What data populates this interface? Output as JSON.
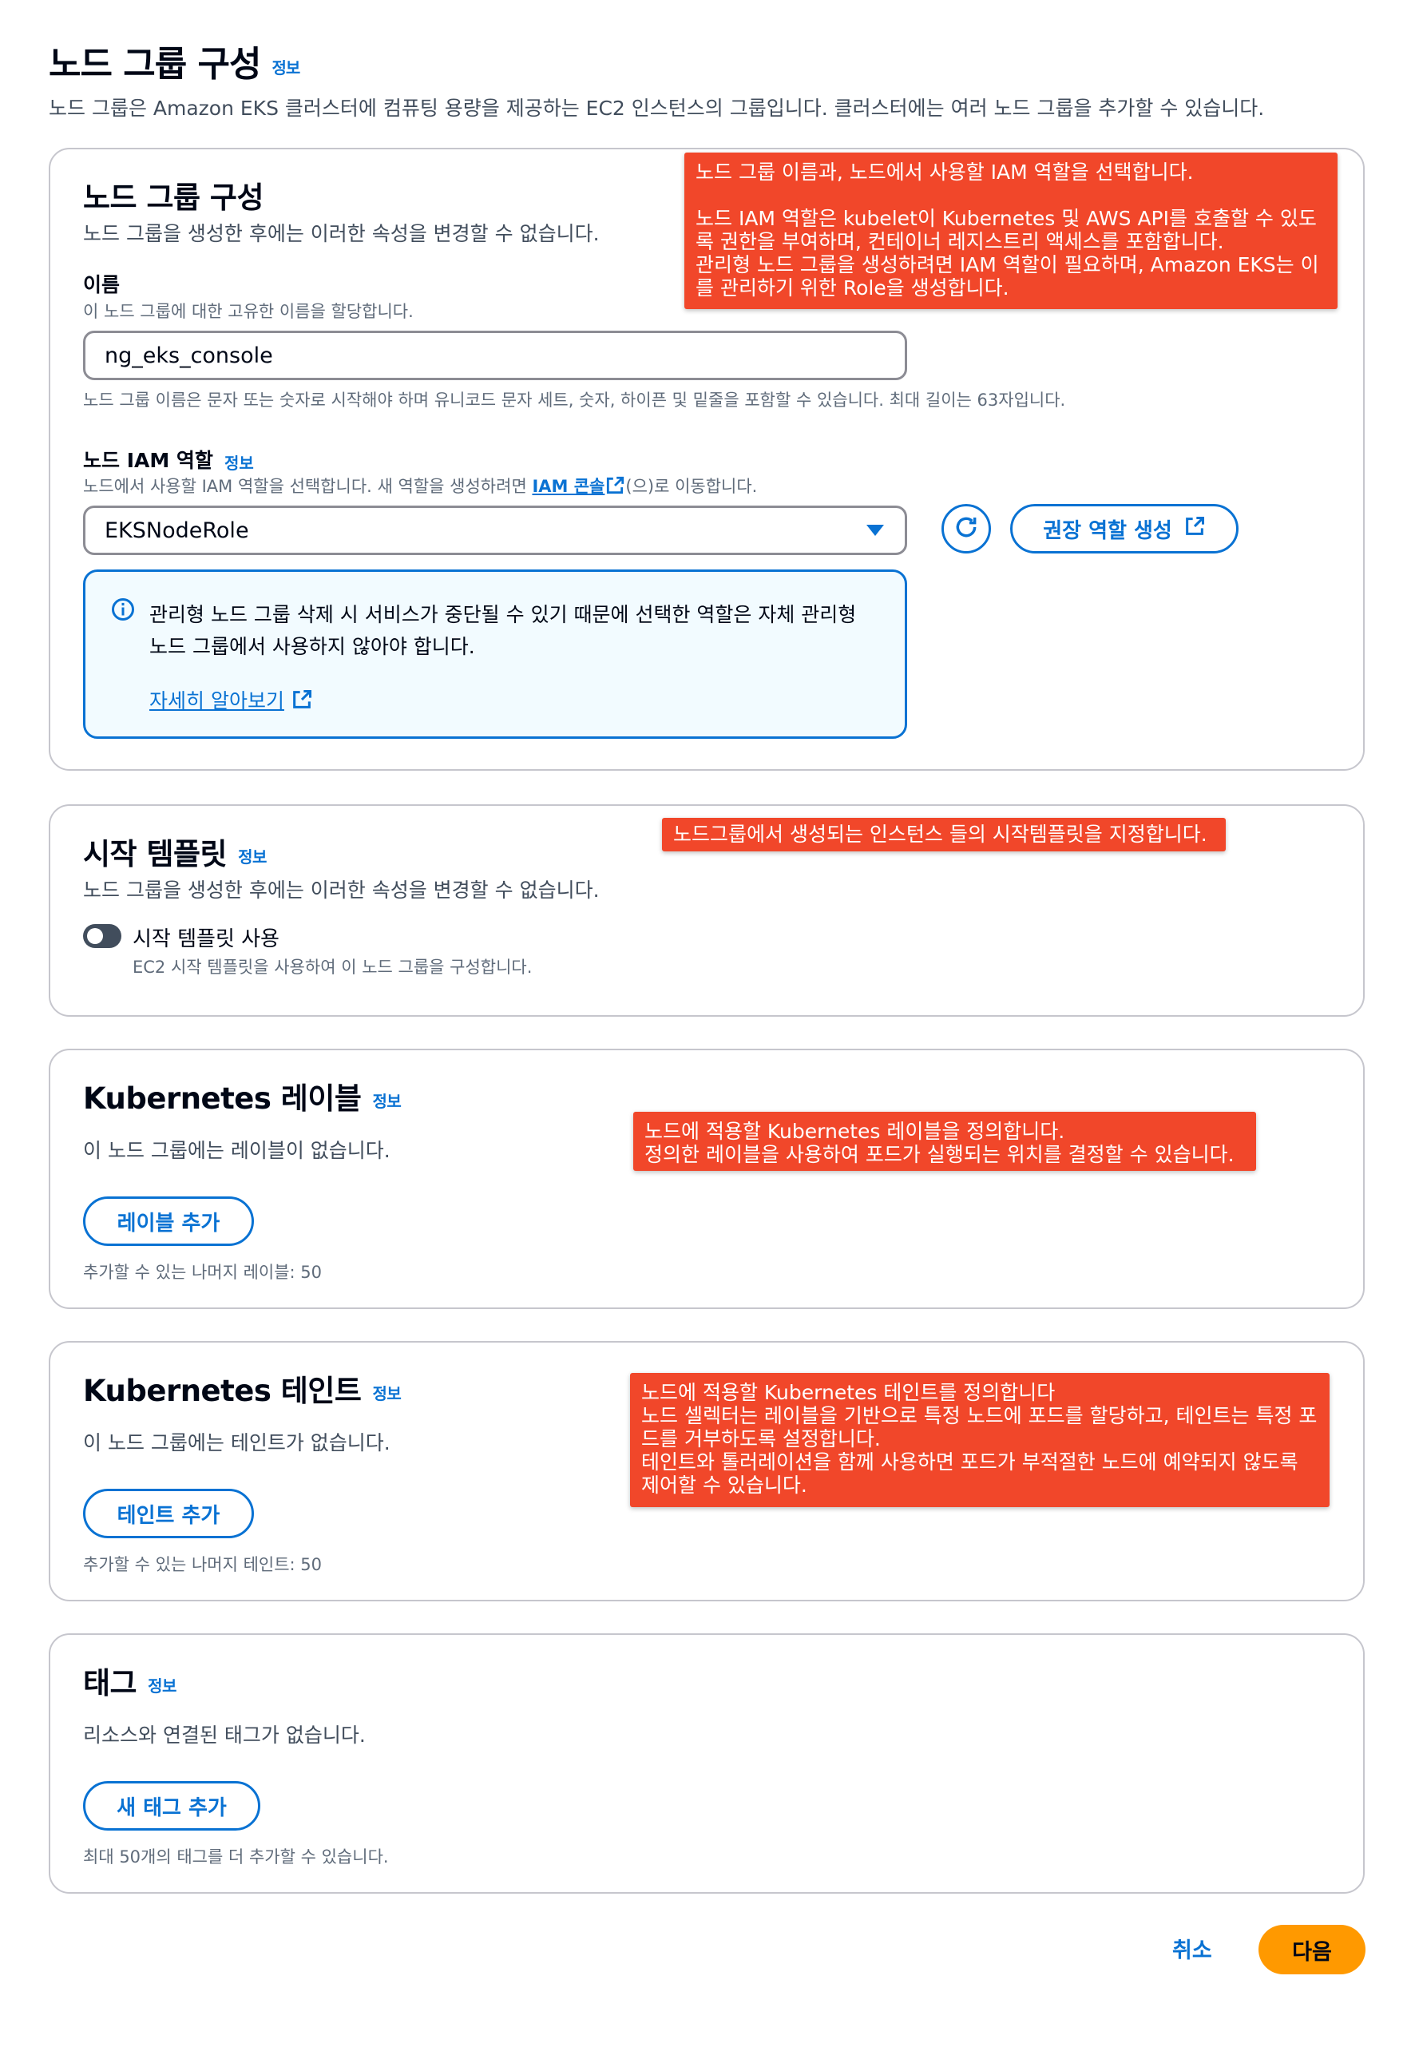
{
  "header": {
    "title": "노드 그룹 구성",
    "info": "정보",
    "description": "노드 그룹은 Amazon EKS 클러스터에 컴퓨팅 용량을 제공하는 EC2 인스턴스의 그룹입니다. 클러스터에는 여러 노드 그룹을 추가할 수 있습니다."
  },
  "node_group_config": {
    "title": "노드 그룹 구성",
    "subtitle": "노드 그룹을 생성한 후에는 이러한 속성을 변경할 수 없습니다.",
    "name_label": "이름",
    "name_hint": "이 노드 그룹에 대한 고유한 이름을 할당합니다.",
    "name_value": "ng_eks_console",
    "name_constraint": "노드 그룹 이름은 문자 또는 숫자로 시작해야 하며 유니코드 문자 세트, 숫자, 하이픈 및 밑줄을 포함할 수 있습니다. 최대 길이는 63자입니다.",
    "iam_label": "노드 IAM 역할",
    "iam_info": "정보",
    "iam_hint_prefix": "노드에서 사용할 IAM 역할을 선택합니다. 새 역할을 생성하려면",
    "iam_hint_link": "IAM 콘솔",
    "iam_hint_suffix": "(으)로 이동합니다.",
    "iam_value": "EKSNodeRole",
    "create_role_button": "권장 역할 생성",
    "alert_text": "관리형 노드 그룹 삭제 시 서비스가 중단될 수 있기 때문에 선택한 역할은 자체 관리형 노드 그룹에서 사용하지 않아야 합니다.",
    "alert_link": "자세히 알아보기"
  },
  "launch_template": {
    "title": "시작 템플릿",
    "info": "정보",
    "subtitle": "노드 그룹을 생성한 후에는 이러한 속성을 변경할 수 없습니다.",
    "toggle_label": "시작 템플릿 사용",
    "toggle_hint": "EC2 시작 템플릿을 사용하여 이 노드 그룹을 구성합니다.",
    "toggle_on": false
  },
  "k8s_labels": {
    "title": "Kubernetes 레이블",
    "info": "정보",
    "empty": "이 노드 그룹에는 레이블이 없습니다.",
    "add_button": "레이블 추가",
    "remaining": "추가할 수 있는 나머지 레이블: 50"
  },
  "k8s_taints": {
    "title": "Kubernetes 테인트",
    "info": "정보",
    "empty": "이 노드 그룹에는 테인트가 없습니다.",
    "add_button": "테인트 추가",
    "remaining": "추가할 수 있는 나머지 테인트: 50"
  },
  "tags": {
    "title": "태그",
    "info": "정보",
    "empty": "리소스와 연결된 태그가 없습니다.",
    "add_button": "새 태그 추가",
    "remaining": "최대 50개의 태그를 더 추가할 수 있습니다."
  },
  "footer": {
    "cancel": "취소",
    "next": "다음"
  },
  "annotations": {
    "a1": "노드 그룹 이름과, 노드에서 사용할 IAM 역할을 선택합니다.\n\n노드 IAM 역할은 kubelet이 Kubernetes 및 AWS API를 호출할 수 있도록 권한을 부여하며, 컨테이너 레지스트리 액세스를 포함합니다.\n관리형 노드 그룹을 생성하려면 IAM 역할이 필요하며, Amazon EKS는 이를 관리하기 위한 Role을 생성합니다.",
    "a2": "노드그룹에서 생성되는 인스턴스 들의 시작템플릿을 지정합니다.",
    "a3": "노드에 적용할 Kubernetes 레이블을 정의합니다.\n정의한 레이블을 사용하여 포드가 실행되는 위치를 결정할 수 있습니다.",
    "a4": "노드에 적용할 Kubernetes 테인트를 정의합니다\n노드 셀렉터는 레이블을 기반으로 특정 노드에 포드를 할당하고, 테인트는 특정 포드를 거부하도록 설정합니다.\n테인트와 톨러레이션을 함께 사용하면 포드가 부적절한 노드에 예약되지 않도록 제어할 수 있습니다."
  },
  "colors": {
    "accent": "#0972d3",
    "annotation": "#f1472a",
    "primary_button": "#ff9900",
    "alert_bg": "#f2fbff"
  }
}
